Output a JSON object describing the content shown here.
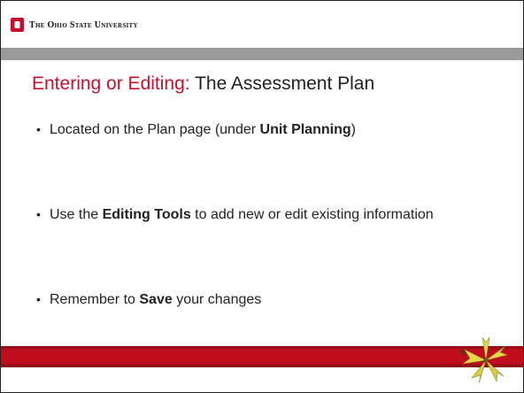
{
  "header": {
    "university_name": "The Ohio State University",
    "logo_icon": "block-o-logo-icon",
    "brand_red": "#c8102e",
    "gray": "#9a9a9a"
  },
  "slide": {
    "title_accent": "Entering or Editing:",
    "title_main": " The Assessment Plan",
    "bullets": [
      {
        "parts": [
          {
            "text": "Located on the Plan page (under ",
            "bold": false
          },
          {
            "text": "Unit Planning",
            "bold": true
          },
          {
            "text": ")",
            "bold": false
          }
        ]
      },
      {
        "parts": [
          {
            "text": "Use the ",
            "bold": false
          },
          {
            "text": "Editing Tools",
            "bold": true
          },
          {
            "text": " to add new or edit existing information",
            "bold": false
          }
        ]
      },
      {
        "parts": [
          {
            "text": "Remember to ",
            "bold": false
          },
          {
            "text": "Save",
            "bold": true
          },
          {
            "text": " your changes",
            "bold": false
          }
        ]
      }
    ],
    "bullet_glyph": "•",
    "footer_icon": "buckeye-leaf-icon"
  }
}
